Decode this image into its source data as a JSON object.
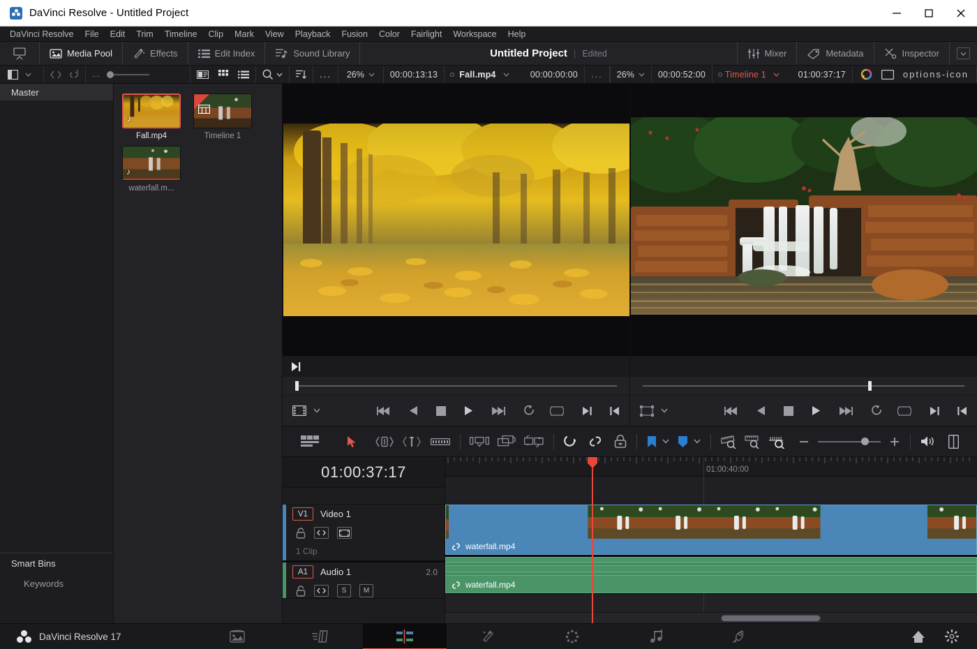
{
  "window": {
    "title": "DaVinci Resolve - Untitled Project",
    "app_icon": "davinci-resolve-icon",
    "minimize": "minimize-icon",
    "maximize": "maximize-icon",
    "close": "close-icon"
  },
  "menubar": {
    "items": [
      "DaVinci Resolve",
      "File",
      "Edit",
      "Trim",
      "Timeline",
      "Clip",
      "Mark",
      "View",
      "Playback",
      "Fusion",
      "Color",
      "Fairlight",
      "Workspace",
      "Help"
    ]
  },
  "toolbar": {
    "left": [
      {
        "label": "",
        "icon": "project-manager-icon"
      },
      {
        "label": "Media Pool",
        "icon": "media-pool-icon"
      },
      {
        "label": "Effects",
        "icon": "effects-icon"
      },
      {
        "label": "Edit Index",
        "icon": "edit-index-icon"
      },
      {
        "label": "Sound Library",
        "icon": "sound-library-icon"
      }
    ],
    "project_title": "Untitled Project",
    "project_separator": "|",
    "project_status": "Edited",
    "right": [
      {
        "label": "Mixer",
        "icon": "mixer-icon"
      },
      {
        "label": "Metadata",
        "icon": "metadata-icon"
      },
      {
        "label": "Inspector",
        "icon": "inspector-icon"
      }
    ],
    "expand_chevron": "chevron-down-icon"
  },
  "subbar": {
    "pool_view_icon": "sidebar-toggle-icon",
    "pool_view_chevron": "chevron-down-icon",
    "clip_link_icon": "clip-link-icon",
    "unlink_icon": "unlink-icon",
    "ellipsis": "...",
    "thumb_size_slider": "thumbnail-size-slider",
    "view_metadata_icon": "metadata-view-icon",
    "view_thumbnail_icon": "thumbnail-view-icon",
    "view_list_icon": "list-view-icon",
    "search_icon": "search-icon",
    "sort_icon": "sort-icon",
    "options_icon": "options-icon",
    "source_zoom": "26%",
    "source_duration": "00:00:13:13",
    "source_clip_name": "Fall.mp4",
    "source_timecode": "00:00:00:00",
    "source_options": "options-icon",
    "timeline_zoom": "26%",
    "timeline_duration": "00:00:52:00",
    "timeline_name": "Timeline 1",
    "timeline_timecode": "01:00:37:17",
    "color_wheel_icon": "color-icon",
    "viewer_mode_icon": "viewer-mode-icon",
    "timeline_options": "options-icon"
  },
  "bins": {
    "master_label": "Master",
    "smart_bins_label": "Smart Bins",
    "keywords_label": "Keywords"
  },
  "media_pool": {
    "items": [
      {
        "name": "Fall.mp4",
        "type": "video",
        "selected": true,
        "has_audio": true
      },
      {
        "name": "Timeline 1",
        "type": "timeline",
        "selected": false,
        "has_audio": false
      },
      {
        "name": "waterfall.m...",
        "type": "video",
        "selected": false,
        "has_audio": true
      }
    ]
  },
  "source_viewer": {
    "playhead_percent": 1,
    "transport": {
      "mode_icon": "source-mode-icon",
      "mode_chevron": "chevron-down-icon",
      "jump_start": "jump-to-start-icon",
      "reverse": "play-reverse-icon",
      "stop": "stop-icon",
      "play": "play-icon",
      "jump_end": "jump-to-end-icon",
      "loop": "loop-icon",
      "mark_clip": "mark-clip-icon",
      "mark_out": "mark-out-icon",
      "mark_in": "mark-in-icon"
    },
    "goto_end_icon": "go-to-end-icon"
  },
  "timeline_viewer": {
    "playhead_percent": 70,
    "transport": {
      "mode_icon": "timeline-mode-icon",
      "mode_chevron": "chevron-down-icon",
      "jump_start": "jump-to-start-icon",
      "reverse": "play-reverse-icon",
      "stop": "stop-icon",
      "play": "play-icon",
      "jump_end": "jump-to-end-icon",
      "loop": "loop-icon",
      "mark_clip": "mark-clip-icon",
      "mark_out": "mark-out-icon",
      "mark_in": "mark-in-icon"
    }
  },
  "timeline_toolbar": {
    "tools": [
      {
        "icon": "timeline-view-options-icon",
        "active": false
      },
      {
        "icon": "selection-tool-icon",
        "active": true
      },
      {
        "icon": "trim-edit-tool-icon",
        "active": false
      },
      {
        "icon": "dynamic-trim-tool-icon",
        "active": false
      },
      {
        "icon": "razor-tool-icon",
        "active": false
      },
      {
        "icon": "insert-clip-icon",
        "active": false
      },
      {
        "icon": "overwrite-clip-icon",
        "active": false
      },
      {
        "icon": "replace-clip-icon",
        "active": false
      },
      {
        "icon": "snapping-icon",
        "active": false
      },
      {
        "icon": "link-clips-icon",
        "active": false
      },
      {
        "icon": "lock-track-icon",
        "active": false
      }
    ],
    "flag_icon": "flag-icon",
    "flag_chevron": "chevron-down-icon",
    "marker_icon": "marker-icon",
    "marker_chevron": "chevron-down-icon",
    "zoom_full_icon": "zoom-full-extent-icon",
    "zoom_detail_icon": "zoom-detail-icon",
    "zoom_custom_icon": "zoom-custom-icon",
    "zoom_out": "−",
    "zoom_in": "+",
    "audio_icon": "audio-meter-icon",
    "panel_icon": "panel-toggle-icon"
  },
  "timeline": {
    "timecode": "01:00:37:17",
    "ruler_label": "01:00:40:00",
    "tracks": [
      {
        "badge": "V1",
        "name": "Video 1",
        "clip_count": "1 Clip",
        "channels": "",
        "type": "video",
        "lock_icon": "lock-icon",
        "auto_select_icon": "auto-select-icon",
        "thumbnail_icon": "track-thumbnail-icon",
        "clip": {
          "name": "waterfall.mp4",
          "link_icon": "link-icon"
        }
      },
      {
        "badge": "A1",
        "name": "Audio 1",
        "clip_count": "",
        "channels": "2.0",
        "type": "audio",
        "lock_icon": "lock-icon",
        "auto_select_icon": "auto-select-icon",
        "solo_label": "S",
        "mute_label": "M",
        "clip": {
          "name": "waterfall.mp4",
          "link_icon": "link-icon"
        }
      }
    ]
  },
  "statusbar": {
    "brand": "DaVinci Resolve 17",
    "brand_icon": "resolve-logo-icon",
    "pages": [
      {
        "name": "media-page",
        "icon": "media-page-icon",
        "active": false
      },
      {
        "name": "cut-page",
        "icon": "cut-page-icon",
        "active": false
      },
      {
        "name": "edit-page",
        "icon": "edit-page-icon",
        "active": true
      },
      {
        "name": "fusion-page",
        "icon": "fusion-page-icon",
        "active": false
      },
      {
        "name": "color-page",
        "icon": "color-page-icon",
        "active": false
      },
      {
        "name": "fairlight-page",
        "icon": "fairlight-page-icon",
        "active": false
      },
      {
        "name": "deliver-page",
        "icon": "deliver-page-icon",
        "active": false
      }
    ],
    "home_icon": "home-icon",
    "settings_icon": "settings-icon"
  },
  "colors": {
    "accent_red": "#e0584c",
    "video_clip": "#4a86b8",
    "audio_clip": "#4a9468",
    "playhead": "#e8483a",
    "panel_bg": "#1d1d20"
  }
}
